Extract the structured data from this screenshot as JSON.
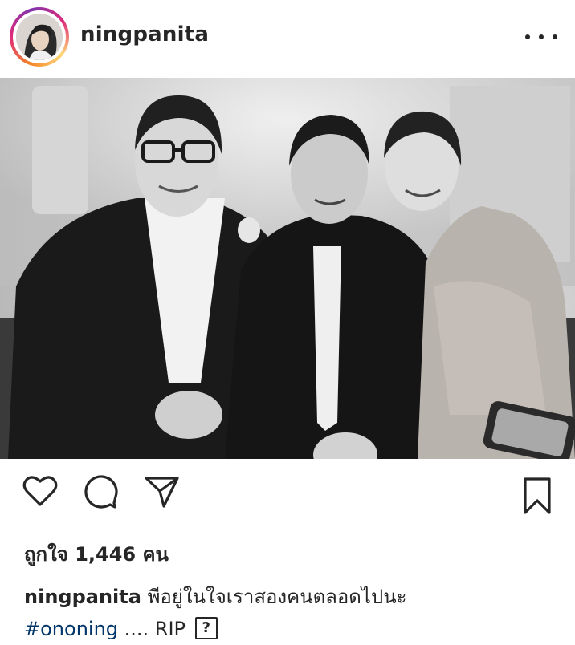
{
  "post": {
    "username": "ningpanita",
    "more_icon": "more-horizontal-icon"
  },
  "photo": {
    "description_icon": "post-photo",
    "tone": "black-and-white"
  },
  "actions": {
    "like_icon": "heart-icon",
    "comment_icon": "comment-icon",
    "share_icon": "send-icon",
    "save_icon": "bookmark-icon"
  },
  "likes": {
    "text": "ถูกใจ 1,446 คน"
  },
  "caption": {
    "username": "ningpanita",
    "text": "พีอยู่ในใจเราสองคนตลอดไปนะ",
    "hashtag": "#ononing",
    "trailing": ".... RIP",
    "unknown_char": "?"
  },
  "colors": {
    "text": "#262626",
    "hashtag": "#003569",
    "background": "#ffffff"
  }
}
